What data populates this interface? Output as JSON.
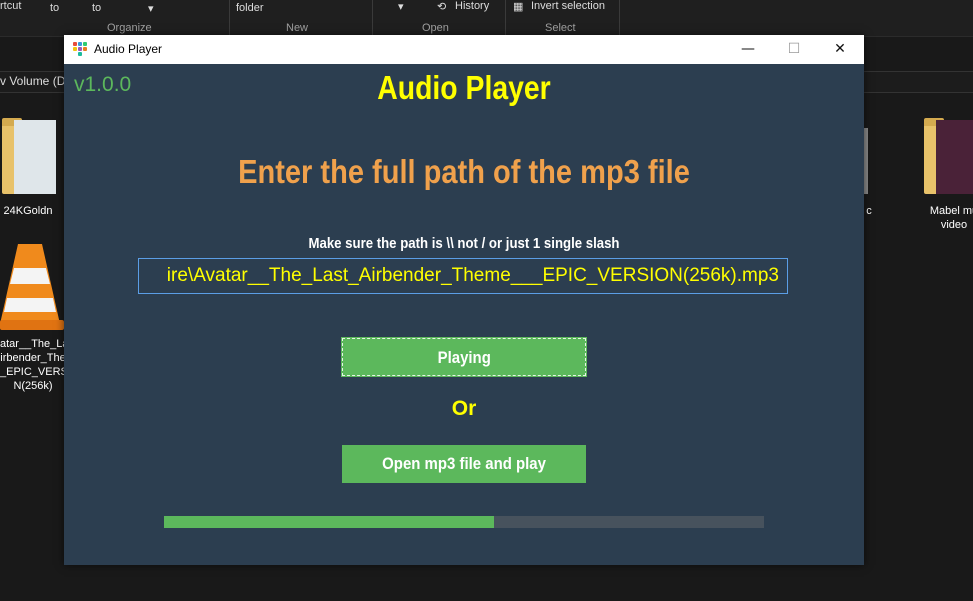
{
  "explorer": {
    "ribbon": {
      "items": [
        "rtcut",
        "to",
        "to",
        "folder",
        "History",
        "Invert selection"
      ],
      "groups": [
        "Organize",
        "New",
        "Open",
        "Select"
      ]
    },
    "address": "v Volume (D",
    "desktop_items": [
      "24KGoldn",
      "atar__The_La\nirbender_The\n_EPIC_VERSI\nN(256k)",
      "c",
      "Mabel mu\nvideo"
    ]
  },
  "window": {
    "title": "Audio Player",
    "controls": {
      "minimize": "—",
      "maximize": "☐",
      "close": "✕"
    }
  },
  "app": {
    "version": "v1.0.0",
    "heading": "Audio Player",
    "subheading": "Enter the full path of the mp3 file",
    "hint": "Make sure the path is \\\\ not / or just 1 single slash",
    "path_value": "ire\\Avatar__The_Last_Airbender_Theme___EPIC_VERSION(256k).mp3",
    "playing_button": "Playing",
    "or_label": "Or",
    "open_button": "Open mp3 file and play",
    "progress": 0.55
  },
  "colors": {
    "bg": "#2c3e50",
    "accent_green": "#5cb85c",
    "yellow": "#ffff00",
    "orange": "#f0a14c",
    "track": "#47525d"
  }
}
